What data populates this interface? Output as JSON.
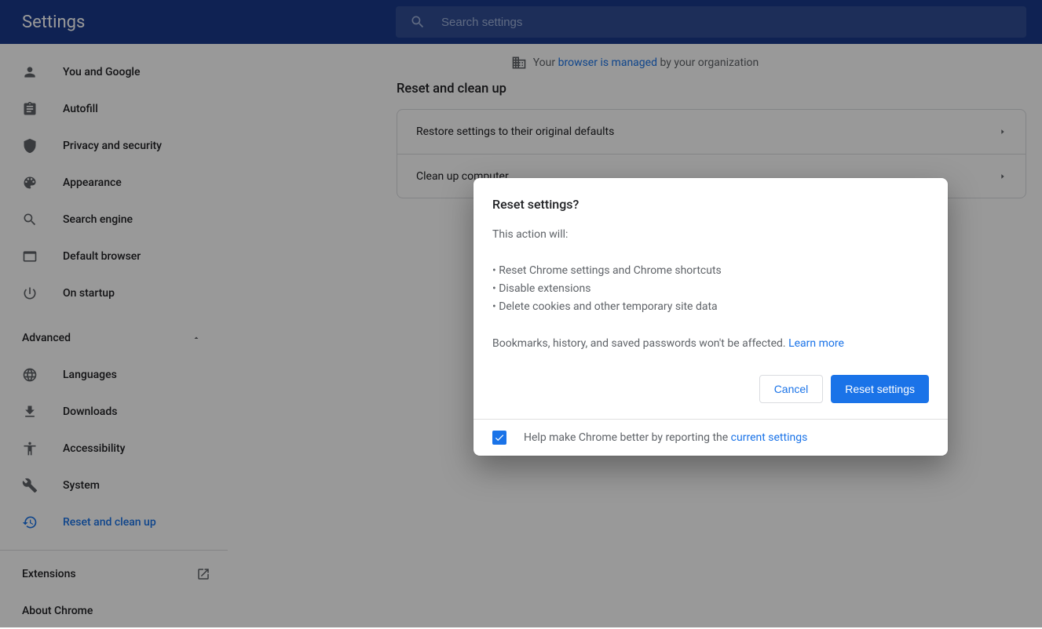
{
  "header": {
    "title": "Settings",
    "search_placeholder": "Search settings"
  },
  "sidebar": {
    "items": [
      {
        "label": "You and Google"
      },
      {
        "label": "Autofill"
      },
      {
        "label": "Privacy and security"
      },
      {
        "label": "Appearance"
      },
      {
        "label": "Search engine"
      },
      {
        "label": "Default browser"
      },
      {
        "label": "On startup"
      }
    ],
    "advanced_label": "Advanced",
    "adv_items": [
      {
        "label": "Languages"
      },
      {
        "label": "Downloads"
      },
      {
        "label": "Accessibility"
      },
      {
        "label": "System"
      },
      {
        "label": "Reset and clean up"
      }
    ],
    "footer_extensions": "Extensions",
    "footer_about": "About Chrome"
  },
  "managed": {
    "pre": "Your ",
    "link": "browser is managed",
    "post": " by your organization"
  },
  "section": {
    "title": "Reset and clean up"
  },
  "card": {
    "row1": "Restore settings to their original defaults",
    "row2": "Clean up computer"
  },
  "dialog": {
    "title": "Reset settings?",
    "intro": "This action will:",
    "b1": "• Reset Chrome settings and Chrome shortcuts",
    "b2": "• Disable extensions",
    "b3": "• Delete cookies and other temporary site data",
    "tail": "Bookmarks, history, and saved passwords won't be affected. ",
    "learn_more": "Learn more",
    "cancel": "Cancel",
    "confirm": "Reset settings",
    "footer_pre": "Help make Chrome better by reporting the ",
    "footer_link": "current settings"
  }
}
